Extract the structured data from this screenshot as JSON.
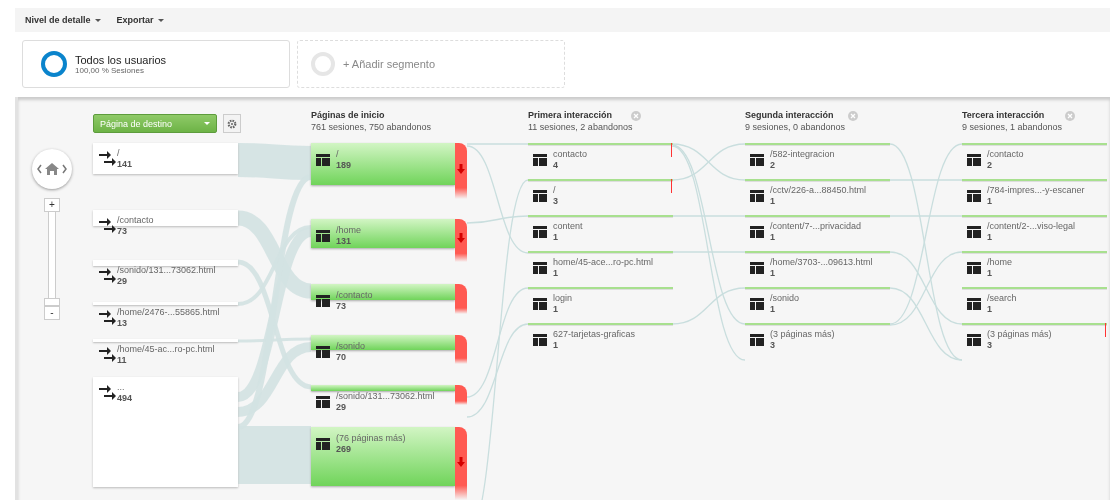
{
  "toolbar": [
    {
      "label": "Nivel de detalle"
    },
    {
      "label": "Exportar"
    }
  ],
  "segments": [
    {
      "kind": "active",
      "title": "Todos los usuarios",
      "subtitle": "100,00 % Sesiones"
    },
    {
      "kind": "add",
      "title": "+ Añadir segmento"
    }
  ],
  "zoom": {
    "plus": "+",
    "minus": "-",
    "level": 0
  },
  "dimension": {
    "label": "Página de destino"
  },
  "source_nodes": [
    {
      "label": "/",
      "count": "141"
    },
    {
      "label": "/contacto",
      "count": "73"
    },
    {
      "label": "/sonido/131...73062.html",
      "count": "29"
    },
    {
      "label": "/home/2476-...55865.html",
      "count": "13"
    },
    {
      "label": "/home/45-ac...ro-pc.html",
      "count": "11"
    },
    {
      "label": "...",
      "count": "494"
    }
  ],
  "columns": [
    {
      "kind": "start",
      "title": "Páginas de inicio",
      "summary": "761 sesiones, 750 abandonos",
      "nodes": [
        {
          "label": "/",
          "count": "189",
          "dropoff_arrow": true
        },
        {
          "label": "/home",
          "count": "131",
          "dropoff_arrow": true
        },
        {
          "label": "/contacto",
          "count": "73",
          "dropoff_arrow": false
        },
        {
          "label": "/sonido",
          "count": "70",
          "dropoff_arrow": false
        },
        {
          "label": "/sonido/131...73062.html",
          "count": "29",
          "dropoff_arrow": false
        },
        {
          "label": "(76 páginas más)",
          "count": "269",
          "dropoff_arrow": true
        }
      ]
    },
    {
      "kind": "interaction",
      "title": "Primera interacción",
      "summary": "11 sesiones, 2 abandonos",
      "nodes": [
        {
          "label": "contacto",
          "count": "4",
          "dropoff": true
        },
        {
          "label": "/",
          "count": "3",
          "dropoff": true
        },
        {
          "label": "content",
          "count": "1",
          "dropoff": false
        },
        {
          "label": "home/45-ace...ro-pc.html",
          "count": "1",
          "dropoff": false
        },
        {
          "label": "login",
          "count": "1",
          "dropoff": false
        },
        {
          "label": "627-tarjetas-graficas",
          "count": "1",
          "dropoff": false
        }
      ]
    },
    {
      "kind": "interaction",
      "title": "Segunda interacción",
      "summary": "9 sesiones, 0 abandonos",
      "nodes": [
        {
          "label": "/582-integracion",
          "count": "2",
          "dropoff": false
        },
        {
          "label": "/cctv/226-a...88450.html",
          "count": "1",
          "dropoff": false
        },
        {
          "label": "/content/7-...privacidad",
          "count": "1",
          "dropoff": false
        },
        {
          "label": "/home/3703-...09613.html",
          "count": "1",
          "dropoff": false
        },
        {
          "label": "/sonido",
          "count": "1",
          "dropoff": false
        },
        {
          "label": "(3 páginas más)",
          "count": "3",
          "dropoff": false
        }
      ]
    },
    {
      "kind": "interaction",
      "title": "Tercera interacción",
      "summary": "9 sesiones, 1 abandonos",
      "nodes": [
        {
          "label": "/contacto",
          "count": "2",
          "dropoff": false
        },
        {
          "label": "/784-impres...-y-escaner",
          "count": "1",
          "dropoff": false
        },
        {
          "label": "/content/2-...viso-legal",
          "count": "1",
          "dropoff": false
        },
        {
          "label": "/home",
          "count": "1",
          "dropoff": false
        },
        {
          "label": "/search",
          "count": "1",
          "dropoff": false
        },
        {
          "label": "(3 páginas más)",
          "count": "3",
          "dropoff": true
        }
      ]
    }
  ]
}
